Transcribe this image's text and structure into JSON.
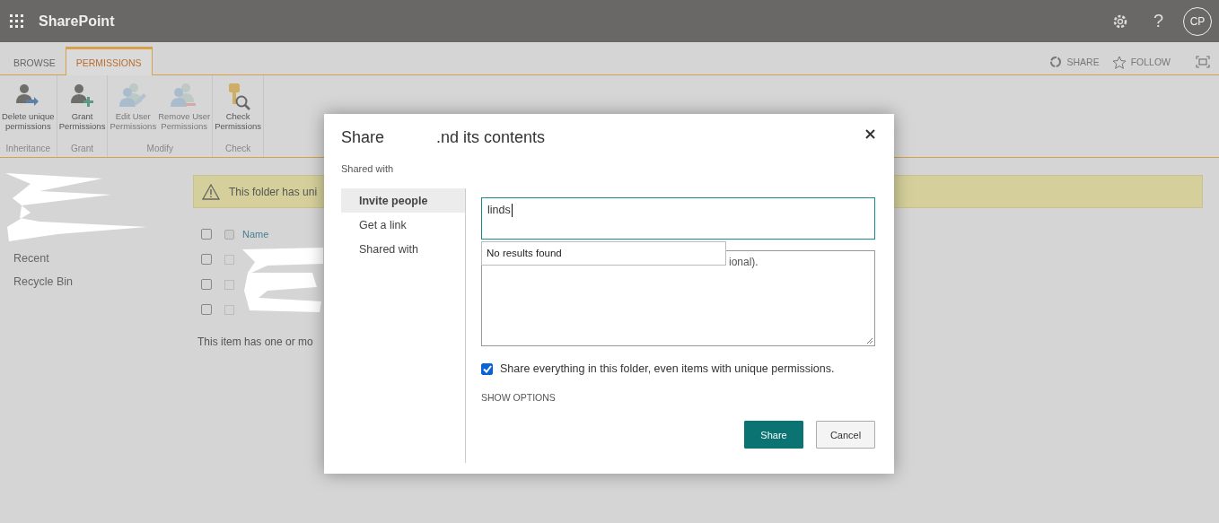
{
  "app_bar": {
    "title": "SharePoint",
    "help": "?",
    "avatar": "CP"
  },
  "ribbon": {
    "tabs": [
      {
        "label": "BROWSE",
        "selected": false
      },
      {
        "label": "PERMISSIONS",
        "selected": true
      }
    ],
    "actions": [
      {
        "label": "SHARE",
        "kind": "share"
      },
      {
        "label": "FOLLOW",
        "kind": "follow"
      }
    ],
    "groups": [
      {
        "name": "Inheritance",
        "buttons": [
          {
            "kind": "delete",
            "lines": [
              "Delete unique",
              "permissions"
            ],
            "disabled": false
          }
        ]
      },
      {
        "name": "Grant",
        "buttons": [
          {
            "kind": "grant",
            "lines": [
              "Grant",
              "Permissions"
            ],
            "disabled": false
          }
        ]
      },
      {
        "name": "Modify",
        "buttons": [
          {
            "kind": "edit",
            "lines": [
              "Edit User",
              "Permissions"
            ],
            "disabled": true
          },
          {
            "kind": "remove",
            "lines": [
              "Remove User",
              "Permissions"
            ],
            "disabled": true
          }
        ]
      },
      {
        "name": "Check",
        "buttons": [
          {
            "kind": "check",
            "lines": [
              "Check",
              "Permissions"
            ],
            "disabled": false
          }
        ]
      }
    ]
  },
  "nav": {
    "items": [
      "Recent",
      "Recycle Bin"
    ]
  },
  "banner": {
    "text": "This folder has uni"
  },
  "list": {
    "column": "Name",
    "header_checked": false,
    "rows": [
      {
        "checked": false
      },
      {
        "checked": false
      },
      {
        "checked": false
      }
    ]
  },
  "note": "This item has one or mo",
  "dialog": {
    "title_start": "Share",
    "title_end": ".nd its contents",
    "subtitle": "Shared with",
    "tabs": [
      {
        "label": "Invite people",
        "selected": true
      },
      {
        "label": "Get a link",
        "selected": false
      },
      {
        "label": "Shared with",
        "selected": false
      }
    ],
    "people_field": {
      "value": "linds"
    },
    "suggestions": [
      "No results found"
    ],
    "message_field": {
      "visible_fragment": "ional)."
    },
    "share_all": {
      "label": "Share everything in this folder, even items with unique permissions.",
      "checked": true
    },
    "show_options": "SHOW OPTIONS",
    "buttons": [
      {
        "label": "Share",
        "kind": "primary"
      },
      {
        "label": "Cancel",
        "kind": "secondary"
      }
    ]
  }
}
